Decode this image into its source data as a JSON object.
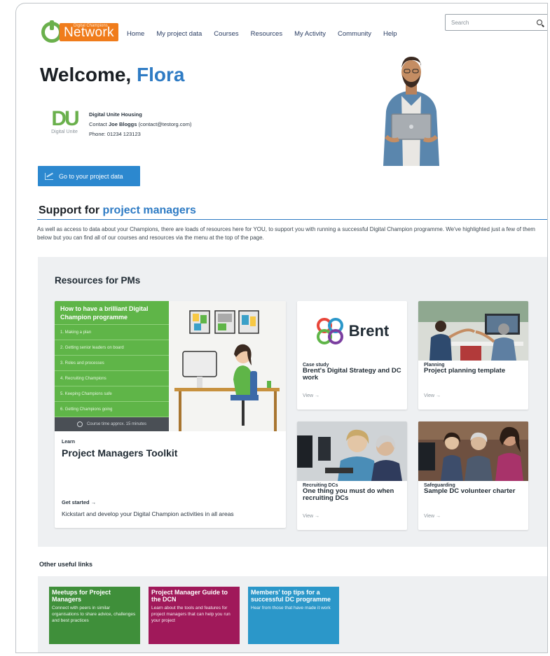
{
  "header": {
    "logo_small": "Digital Champions",
    "logo_main": "Network",
    "nav": [
      "Home",
      "My project data",
      "Courses",
      "Resources",
      "My Activity",
      "Community",
      "Help"
    ],
    "search_placeholder": "Search"
  },
  "welcome": {
    "greeting": "Welcome,",
    "name": "Flora"
  },
  "org": {
    "logo_letters": "DU",
    "logo_sub": "Digital Unite",
    "name": "Digital Unite Housing",
    "contact_prefix": "Contact",
    "contact_name": "Joe Bloggs",
    "contact_email": "(contact@testorg.com)",
    "phone": "Phone: 01234 123123"
  },
  "project_button": "Go to your project data",
  "support": {
    "title_a": "Support for",
    "title_b": "project managers",
    "text": "As well as access to data about your Champions, there are loads of resources here for YOU, to support you with running a successful Digital Champion programme. We've highlighted just a few of them below but you can find all of our courses and resources via the menu at the top of the page."
  },
  "resources": {
    "title": "Resources for PMs",
    "featured": {
      "list_title": "How to have a brilliant Digital Champion programme",
      "list_items": [
        "1. Making a plan",
        "2. Getting senior leaders on board",
        "3. Roles and processes",
        "4. Recruiting Champions",
        "5. Keeping Champions safe",
        "6. Getting Champions going"
      ],
      "course_time": "Course time approx. 15 minutes",
      "tag": "Learn",
      "title": "Project Managers Toolkit",
      "cta": "Get started →",
      "desc": "Kickstart and develop your Digital Champion activities in all areas"
    },
    "cards": [
      {
        "brand": "Brent",
        "tag": "Case study",
        "title": "Brent's Digital Strategy and DC work",
        "view": "View →"
      },
      {
        "tag": "Planning",
        "title": "Project planning template",
        "view": "View →"
      },
      {
        "tag": "Recruiting DCs",
        "title": "One thing you must do when recruiting DCs",
        "view": "View →"
      },
      {
        "tag": "Safeguarding",
        "title": "Sample DC volunteer charter",
        "view": "View →"
      }
    ]
  },
  "other": {
    "title": "Other useful links",
    "links": [
      {
        "title": "Meetups for Project Managers",
        "desc": "Connect with peers in similar organisations to share advice, challenges and best practices",
        "color": "#3f8f3a"
      },
      {
        "title": "Project Manager Guide to the DCN",
        "desc": "Learn about the tools and features for project managers that can help you run your project",
        "color": "#a0195a"
      },
      {
        "title": "Members' top tips for a successful DC programme",
        "desc": "Hear from those that have made it work",
        "color": "#2b97c9"
      }
    ]
  },
  "colors": {
    "accent_blue": "#2e7bc4",
    "brand_green": "#6ab04c",
    "brand_orange": "#f07c1b"
  }
}
